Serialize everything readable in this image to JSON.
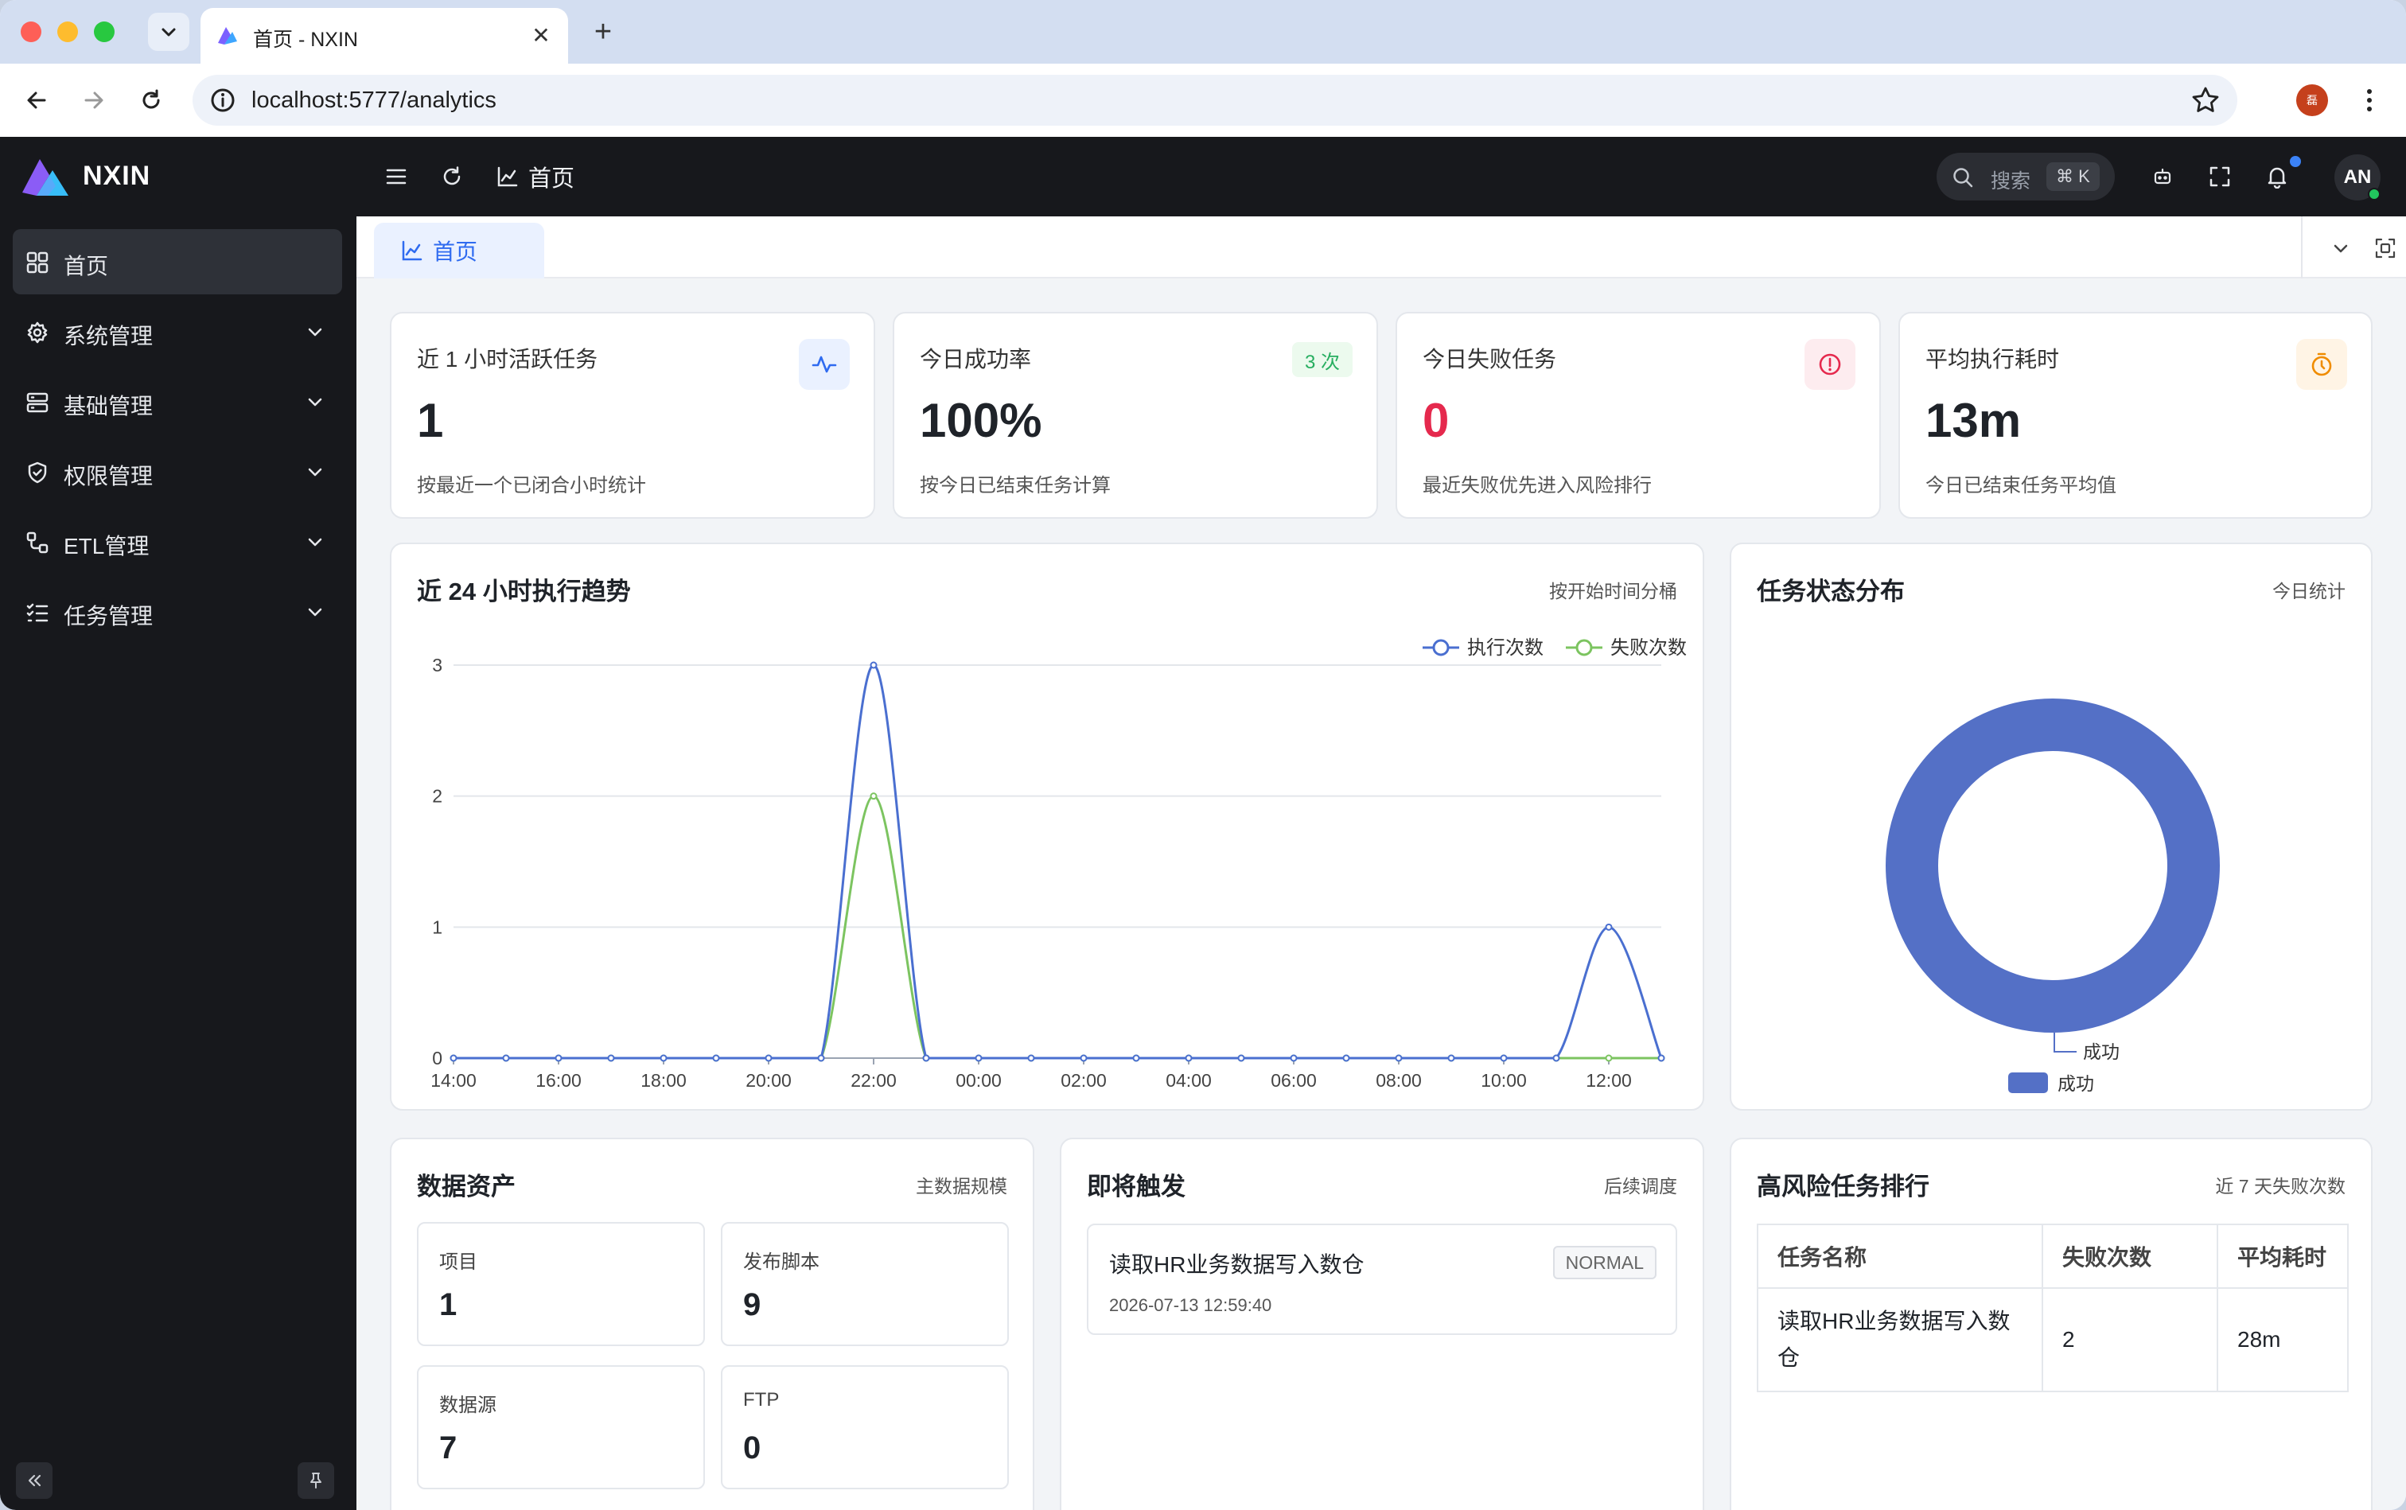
{
  "browser": {
    "tab_title": "首页 - NXIN",
    "url": "localhost:5777/analytics",
    "profile_initial": "磊"
  },
  "app": {
    "brand": "NXIN",
    "colors": {
      "accent": "#2f6bf0",
      "sidebar_bg": "#17181c",
      "danger": "#e5294d",
      "success": "#27ae60",
      "series_exec": "#4a6fd0",
      "series_fail": "#7cc460",
      "donut": "#5470c6"
    }
  },
  "sidebar": {
    "items": [
      {
        "label": "首页",
        "icon": "dashboard-icon",
        "active": true
      },
      {
        "label": "系统管理",
        "icon": "gear-icon"
      },
      {
        "label": "基础管理",
        "icon": "server-icon"
      },
      {
        "label": "权限管理",
        "icon": "shield-icon"
      },
      {
        "label": "ETL管理",
        "icon": "flow-icon"
      },
      {
        "label": "任务管理",
        "icon": "checklist-icon"
      }
    ]
  },
  "header": {
    "breadcrumb": "首页",
    "search_label": "搜索",
    "search_shortcut": "⌘ K",
    "avatar": "AN"
  },
  "tabs": [
    {
      "label": "首页"
    }
  ],
  "stats": [
    {
      "title": "近 1 小时活跃任务",
      "value": "1",
      "desc": "按最近一个已闭合小时统计",
      "icon": "activity-icon"
    },
    {
      "title": "今日成功率",
      "value": "100%",
      "desc": "按今日已结束任务计算",
      "badge": "3 次"
    },
    {
      "title": "今日失败任务",
      "value": "0",
      "desc": "最近失败优先进入风险排行",
      "icon": "alert-circle-icon"
    },
    {
      "title": "平均执行耗时",
      "value": "13m",
      "desc": "今日已结束任务平均值",
      "icon": "timer-icon"
    }
  ],
  "trend": {
    "title": "近 24 小时执行趋势",
    "subtitle": "按开始时间分桶"
  },
  "status": {
    "title": "任务状态分布",
    "subtitle": "今日统计"
  },
  "assets": {
    "title": "数据资产",
    "subtitle": "主数据规模",
    "items": [
      {
        "label": "项目",
        "value": "1"
      },
      {
        "label": "发布脚本",
        "value": "9"
      },
      {
        "label": "数据源",
        "value": "7"
      },
      {
        "label": "FTP",
        "value": "0"
      }
    ]
  },
  "upcoming": {
    "title": "即将触发",
    "subtitle": "后续调度",
    "items": [
      {
        "name": "读取HR业务数据写入数仓",
        "time": "2026-07-13 12:59:40",
        "badge": "NORMAL"
      }
    ]
  },
  "risk": {
    "title": "高风险任务排行",
    "subtitle": "近 7 天失败次数",
    "columns": [
      "任务名称",
      "失败次数",
      "平均耗时"
    ],
    "rows": [
      {
        "name": "读取HR业务数据写入数仓",
        "fails": "2",
        "avg": "28m"
      }
    ]
  },
  "chart_data": [
    {
      "type": "line",
      "x": [
        "14:00",
        "15:00",
        "16:00",
        "17:00",
        "18:00",
        "19:00",
        "20:00",
        "21:00",
        "22:00",
        "23:00",
        "00:00",
        "01:00",
        "02:00",
        "03:00",
        "04:00",
        "05:00",
        "06:00",
        "07:00",
        "08:00",
        "09:00",
        "10:00",
        "11:00",
        "12:00",
        "13:00"
      ],
      "x_tick_labels": [
        "14:00",
        "16:00",
        "18:00",
        "20:00",
        "22:00",
        "00:00",
        "02:00",
        "04:00",
        "06:00",
        "08:00",
        "10:00",
        "12:00"
      ],
      "series": [
        {
          "name": "执行次数",
          "values": [
            0,
            0,
            0,
            0,
            0,
            0,
            0,
            0,
            3,
            0,
            0,
            0,
            0,
            0,
            0,
            0,
            0,
            0,
            0,
            0,
            0,
            0,
            1,
            0
          ]
        },
        {
          "name": "失败次数",
          "values": [
            0,
            0,
            0,
            0,
            0,
            0,
            0,
            0,
            2,
            0,
            0,
            0,
            0,
            0,
            0,
            0,
            0,
            0,
            0,
            0,
            0,
            0,
            0,
            0
          ]
        }
      ],
      "yticks": [
        0,
        1,
        2,
        3
      ],
      "ylim": [
        0,
        3
      ],
      "grid": true,
      "legend": "top-right",
      "smooth": true
    },
    {
      "type": "pie",
      "donut": true,
      "categories": [
        "成功"
      ],
      "values": [
        3
      ],
      "slice_labels": [
        "成功"
      ],
      "legend": "bottom"
    }
  ]
}
